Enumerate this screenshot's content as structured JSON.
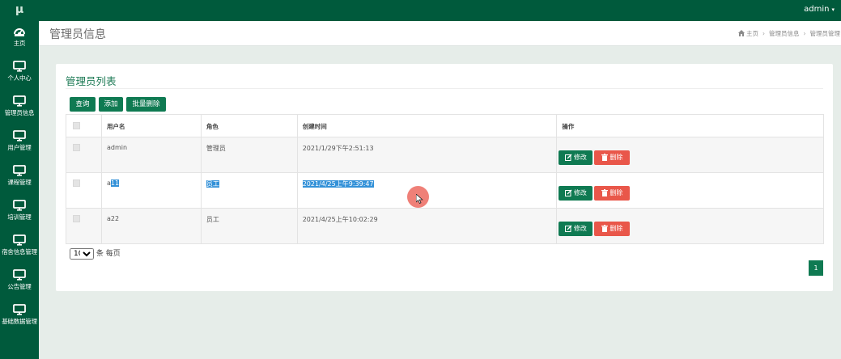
{
  "brand": {
    "logo": "μ"
  },
  "topbar": {
    "username": "admin",
    "caret": "▾"
  },
  "sidebar": {
    "items": [
      {
        "label": "主页",
        "icon": "dashboard-icon"
      },
      {
        "label": "个人中心",
        "icon": "monitor-icon"
      },
      {
        "label": "管理员信息",
        "icon": "monitor-icon"
      },
      {
        "label": "用户管理",
        "icon": "monitor-icon"
      },
      {
        "label": "课程管理",
        "icon": "monitor-icon"
      },
      {
        "label": "培训管理",
        "icon": "monitor-icon"
      },
      {
        "label": "宿舍信息管理",
        "icon": "monitor-icon"
      },
      {
        "label": "公告管理",
        "icon": "monitor-icon"
      },
      {
        "label": "基础数据管理",
        "icon": "monitor-icon"
      }
    ]
  },
  "header": {
    "title": "管理员信息",
    "breadcrumb": [
      "主页",
      "管理员信息",
      "管理员管理"
    ],
    "breadcrumb_sep": "›"
  },
  "panel": {
    "title": "管理员列表",
    "buttons": {
      "query": "查询",
      "add": "添加",
      "batch_delete": "批量删除"
    }
  },
  "table": {
    "headers": [
      "用户名",
      "角色",
      "创建时间",
      "操作"
    ],
    "rows": [
      {
        "username": "admin",
        "role": "管理员",
        "created": "2021/1/29下午2:51:13"
      },
      {
        "username_prefix": "a",
        "username_selected": "11",
        "role": "员工",
        "created": "2021/4/25上午9:39:47"
      },
      {
        "username": "a22",
        "role": "员工",
        "created": "2021/4/25上午10:02:29"
      }
    ],
    "actions": {
      "edit": "修改",
      "delete": "删除"
    }
  },
  "pager": {
    "page_size": "10",
    "page_size_suffix": "条 每页",
    "current_page": "1"
  },
  "colors": {
    "primary": "#005a3c",
    "button_green": "#0f7a52",
    "danger": "#e9574a",
    "selection": "#3391d8",
    "background": "#e6ede9"
  }
}
